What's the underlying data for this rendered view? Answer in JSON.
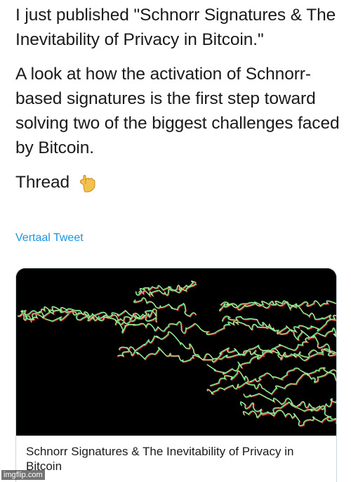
{
  "tweet": {
    "paragraphs": [
      "I just published \"Schnorr Signatures & The Inevitability of Privacy in Bitcoin.\"",
      "A look at how the activation of Schnorr-based signatures is the first step toward solving two of the biggest challenges faced by Bitcoin."
    ],
    "thread_label": "Thread",
    "thread_icon": "pointing-down-emoji",
    "translate_label": "Vertaal Tweet"
  },
  "card": {
    "title": "Schnorr Signatures & The Inevitability of Privacy in Bitcoin",
    "image": "light-trails-image"
  },
  "watermark": {
    "text": "imgflip.com"
  },
  "colors": {
    "link": "#1b95e0",
    "card_border": "#ccd6dd",
    "trail_green": "#3cff6a",
    "trail_red": "#ff2a3c",
    "trail_white": "#ffffff"
  }
}
